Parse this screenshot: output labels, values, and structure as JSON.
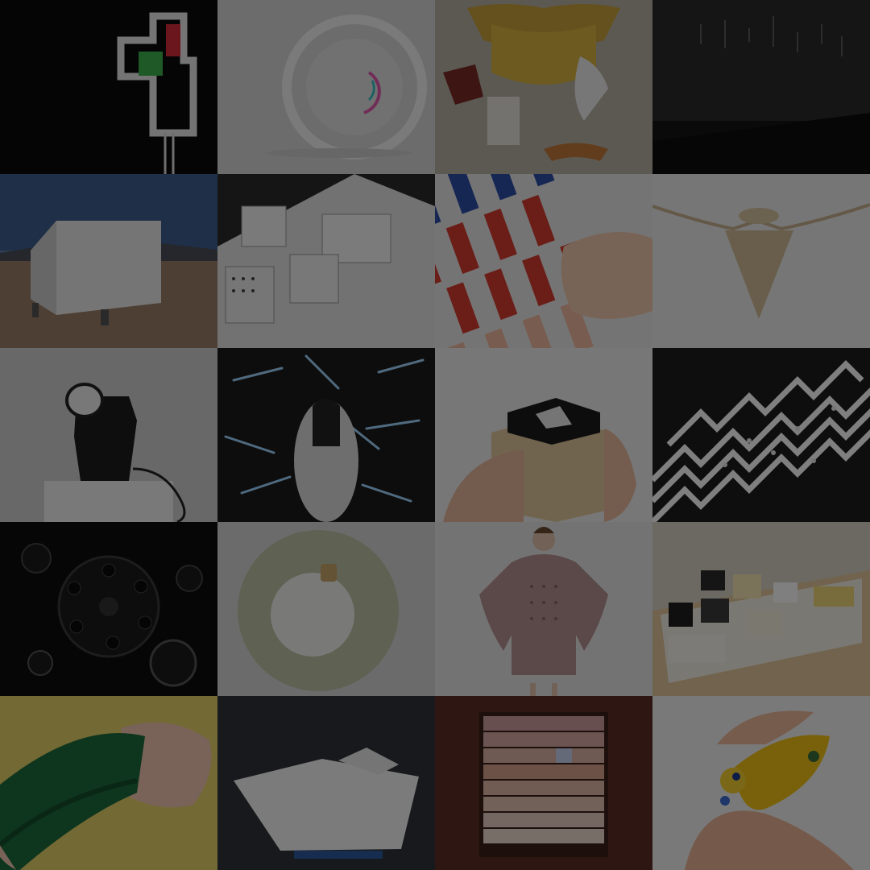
{
  "gallery": {
    "rows": 5,
    "columns": 4,
    "overlay_dim": 0.5,
    "tiles": [
      {
        "subject": "neon-sign-icon",
        "bg": "#0a0a0a"
      },
      {
        "subject": "ring-lamp-icon",
        "bg": "#d8d8d8"
      },
      {
        "subject": "garment-display-icon",
        "bg": "#b9b3a6"
      },
      {
        "subject": "dark-gallery-icon",
        "bg": "#151515"
      },
      {
        "subject": "desert-cabin-icon",
        "bg": "#5c7ba1"
      },
      {
        "subject": "architecture-model-icon",
        "bg": "#2a2a2a"
      },
      {
        "subject": "color-blocks-icon",
        "bg": "#e9e9e9"
      },
      {
        "subject": "pendant-lamp-icon",
        "bg": "#ececec"
      },
      {
        "subject": "speaker-device-icon",
        "bg": "#d0d0d0"
      },
      {
        "subject": "light-sticks-installation-icon",
        "bg": "#1a1a1a"
      },
      {
        "subject": "wooden-stamp-icon",
        "bg": "#eeeeee"
      },
      {
        "subject": "zebra-crossing-icon",
        "bg": "#1d1d1d"
      },
      {
        "subject": "watch-parts-icon",
        "bg": "#0c0c0c"
      },
      {
        "subject": "fur-lamp-icon",
        "bg": "#d6d6d6"
      },
      {
        "subject": "fashion-model-icon",
        "bg": "#e6e6e6"
      },
      {
        "subject": "block-set-icon",
        "bg": "#d8d2c4"
      },
      {
        "subject": "wrist-brace-icon",
        "bg": "#e6d36a"
      },
      {
        "subject": "pentagon-table-icon",
        "bg": "#2e3238"
      },
      {
        "subject": "swatch-shelf-icon",
        "bg": "#5d2e24"
      },
      {
        "subject": "yellow-toy-icon",
        "bg": "#f2f2f2"
      }
    ]
  }
}
